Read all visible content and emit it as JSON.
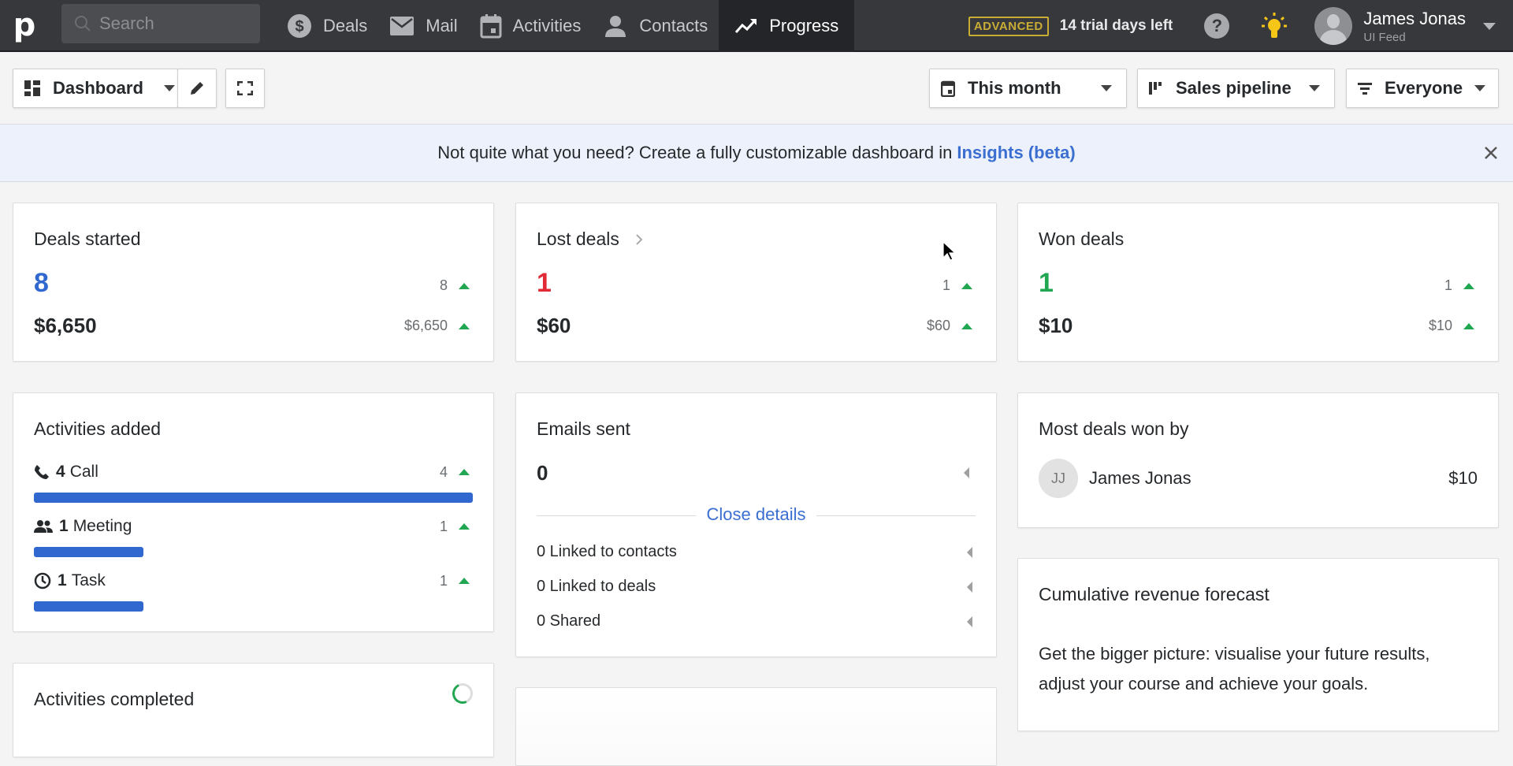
{
  "topbar": {
    "logo": "p",
    "search_placeholder": "Search",
    "nav": [
      {
        "label": "Deals",
        "icon": "dollar-icon"
      },
      {
        "label": "Mail",
        "icon": "mail-icon"
      },
      {
        "label": "Activities",
        "icon": "calendar-icon"
      },
      {
        "label": "Contacts",
        "icon": "person-icon"
      },
      {
        "label": "Progress",
        "icon": "trending-up-icon",
        "active": true
      }
    ],
    "plan_badge": "ADVANCED",
    "trial_text": "14 trial days left",
    "help_label": "?",
    "user": {
      "name": "James Jonas",
      "company": "UI Feed"
    }
  },
  "toolbar": {
    "dashboard_label": "Dashboard",
    "period": "This month",
    "pipeline": "Sales pipeline",
    "filter": "Everyone"
  },
  "banner": {
    "text": "Not quite what you need? Create a fully customizable dashboard in",
    "link": "Insights (beta)"
  },
  "colors": {
    "accent": "#3168d0",
    "lost": "#e02b36",
    "won": "#21a652",
    "link": "#3a6fd1"
  },
  "cards": {
    "deals_started": {
      "title": "Deals started",
      "count": "8",
      "value": "$6,650",
      "cmp_count": "8",
      "cmp_value": "$6,650"
    },
    "lost_deals": {
      "title": "Lost deals",
      "count": "1",
      "value": "$60",
      "cmp_count": "1",
      "cmp_value": "$60"
    },
    "won_deals": {
      "title": "Won deals",
      "count": "1",
      "value": "$10",
      "cmp_count": "1",
      "cmp_value": "$10"
    },
    "activities_added": {
      "title": "Activities added",
      "items": [
        {
          "count": "4",
          "label": "Call",
          "cmp": "4",
          "fraction": 1.0
        },
        {
          "count": "1",
          "label": "Meeting",
          "cmp": "1",
          "fraction": 0.25
        },
        {
          "count": "1",
          "label": "Task",
          "cmp": "1",
          "fraction": 0.25
        }
      ]
    },
    "emails_sent": {
      "title": "Emails sent",
      "count": "0",
      "toggle": "Close details",
      "details": [
        "0 Linked to contacts",
        "0 Linked to deals",
        "0 Shared"
      ]
    },
    "most_deals_won": {
      "title": "Most deals won by",
      "initials": "JJ",
      "name": "James Jonas",
      "value": "$10"
    },
    "forecast": {
      "title": "Cumulative revenue forecast",
      "line1": "Get the bigger picture: visualise your future results,",
      "line2": "adjust your course and achieve your goals."
    },
    "activities_completed": {
      "title": "Activities completed"
    }
  }
}
